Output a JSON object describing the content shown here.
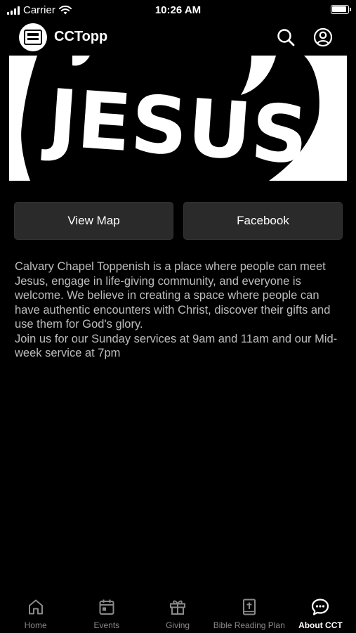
{
  "status": {
    "carrier": "Carrier",
    "time": "10:26 AM"
  },
  "header": {
    "title": "CCTopp",
    "logo_icon": "church-logo-icon",
    "search_icon": "search-icon",
    "account_icon": "account-icon"
  },
  "hero": {
    "text": "JESUS"
  },
  "buttons": {
    "view_map": "View Map",
    "facebook": "Facebook"
  },
  "description": {
    "paragraph1": "Calvary Chapel Toppenish is a place where people can meet Jesus,  engage in life-giving community, and everyone is welcome. We believe in creating a space where people can have authentic encounters with Christ, discover their gifts and use them for God's glory.",
    "paragraph2": "Join us for our Sunday services at 9am and 11am and our Mid-week service at 7pm"
  },
  "tabs": [
    {
      "label": "Home",
      "icon": "home-icon",
      "active": false
    },
    {
      "label": "Events",
      "icon": "calendar-icon",
      "active": false
    },
    {
      "label": "Giving",
      "icon": "gift-icon",
      "active": false
    },
    {
      "label": "Bible Reading Plan",
      "icon": "bible-icon",
      "active": false
    },
    {
      "label": "About CCT",
      "icon": "chat-icon",
      "active": true
    }
  ],
  "colors": {
    "background": "#000000",
    "button_bg": "#2a2a2a",
    "text_muted": "#bdbdbd",
    "tab_inactive": "#8a8a8a"
  }
}
